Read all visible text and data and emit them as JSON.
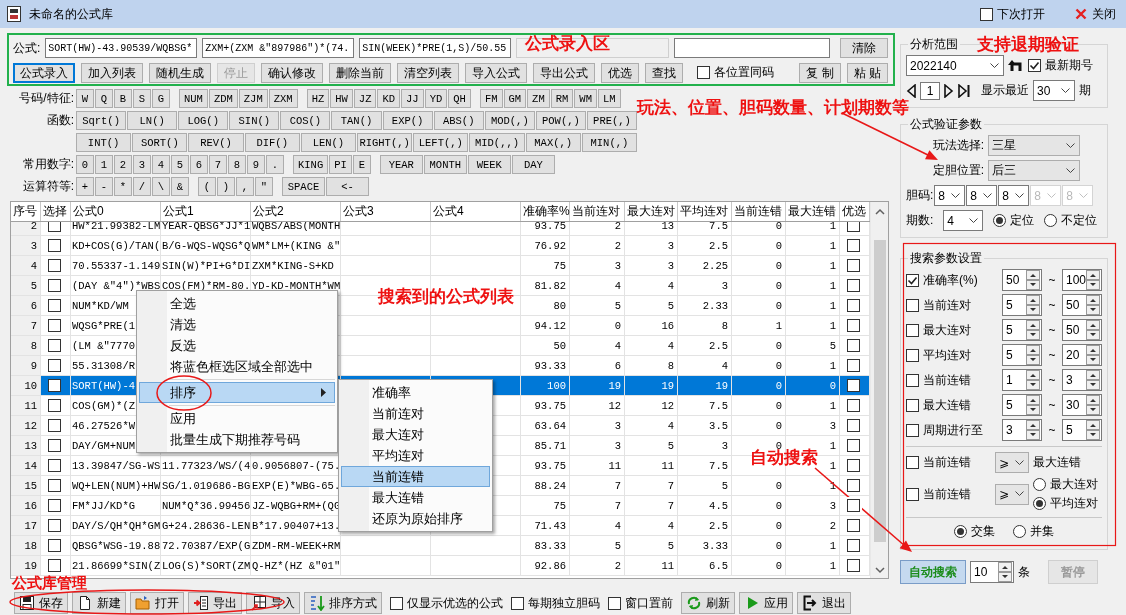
{
  "window": {
    "title": "未命名的公式库",
    "open_next_time": {
      "label": "下次打开",
      "checked": false
    },
    "close": "关闭"
  },
  "formula_area": {
    "label": "公式:",
    "inputs": [
      "SORT(HW)-43.90539/WQBSG*",
      "ZXM+(ZXM &\"897986\")*(74.",
      "SIN(WEEK)*PRE(1,S)/50.55"
    ],
    "clear": "清除",
    "buttons": [
      {
        "kind": "button",
        "label": "公式录入",
        "focused": true,
        "disabled": false
      },
      {
        "kind": "button",
        "label": "加入列表",
        "focused": false,
        "disabled": false
      },
      {
        "kind": "button",
        "label": "随机生成",
        "focused": false,
        "disabled": false
      },
      {
        "kind": "button",
        "label": "停止",
        "focused": false,
        "disabled": true
      },
      {
        "kind": "button",
        "label": "确认修改",
        "focused": false,
        "disabled": false
      },
      {
        "kind": "button",
        "label": "删除当前",
        "focused": false,
        "disabled": false
      },
      {
        "kind": "button",
        "label": "清空列表",
        "focused": false,
        "disabled": false
      },
      {
        "kind": "button",
        "label": "导入公式",
        "focused": false,
        "disabled": false
      },
      {
        "kind": "button",
        "label": "导出公式",
        "focused": false,
        "disabled": false
      },
      {
        "kind": "button",
        "label": "优选",
        "focused": false,
        "disabled": false
      },
      {
        "kind": "button",
        "label": "查找",
        "focused": false,
        "disabled": false
      },
      {
        "kind": "checkbox",
        "label": "各位置同码",
        "checked": false
      },
      {
        "kind": "button",
        "label": "复 制",
        "focused": false,
        "disabled": false
      },
      {
        "kind": "button",
        "label": "粘 贴",
        "focused": false,
        "disabled": false
      }
    ]
  },
  "keypad": {
    "rows": [
      {
        "label": "号码/特征:",
        "kind": "code",
        "groups": [
          {
            "kind": "code",
            "keys": [
              "W",
              "Q",
              "B",
              "S",
              "G"
            ]
          },
          {
            "kind": "code",
            "keys": [
              "NUM",
              "ZDM",
              "ZJM",
              "ZXM"
            ]
          },
          {
            "kind": "code",
            "keys": [
              "HZ",
              "HW",
              "JZ",
              "KD",
              "JJ",
              "YD",
              "QH"
            ]
          },
          {
            "kind": "code",
            "keys": [
              "FM",
              "GM",
              "ZM",
              "RM",
              "WM",
              "LM"
            ]
          }
        ]
      },
      {
        "label": "函数:",
        "kind": "function",
        "groups": [
          {
            "kind": "code",
            "keys": [
              "Sqrt()",
              "LN()",
              "LOG()",
              "SIN()",
              "COS()",
              "TAN()",
              "EXP()",
              "ABS()",
              "MOD(,)",
              "POW(,)",
              "PRE(,)"
            ]
          }
        ]
      },
      {
        "kind": "function",
        "groups": [
          {
            "kind": "code",
            "keys": [
              "INT()",
              "SORT()",
              "REV()",
              "DIF()",
              "LEN()",
              "RIGHT(,)",
              "LEFT(,)",
              "MID(,,)",
              "MAX(,)",
              "MIN(,)"
            ]
          }
        ]
      },
      {
        "label": "常用数字:",
        "kind": "code",
        "groups": [
          {
            "kind": "code",
            "keys": [
              "0",
              "1",
              "2",
              "3",
              "4",
              "5",
              "6",
              "7",
              "8",
              "9",
              "."
            ]
          },
          {
            "kind": "code",
            "keys": [
              "KING",
              "PI",
              "E"
            ]
          },
          {
            "kind": "word",
            "keys": [
              "YEAR",
              "MONTH",
              "WEEK",
              "DAY"
            ]
          }
        ]
      },
      {
        "label": "运算符等:",
        "kind": "code",
        "groups": [
          {
            "kind": "code",
            "keys": [
              "+",
              "-",
              "*",
              "/",
              "\\",
              "&"
            ]
          },
          {
            "kind": "code",
            "keys": [
              "(",
              ")",
              ",",
              "\""
            ]
          },
          {
            "kind": "word",
            "keys": [
              "SPACE",
              "<-"
            ]
          }
        ]
      }
    ]
  },
  "table": {
    "columns": [
      "序号",
      "选择",
      "公式0",
      "公式1",
      "公式2",
      "公式3",
      "公式4",
      "准确率%",
      "当前连对",
      "最大连对",
      "平均连对",
      "当前连错",
      "最大连错",
      "优选"
    ],
    "rows": [
      {
        "no": "2",
        "checked": false,
        "formulas": [
          "HW*21.99382-LM",
          "YEAR-QBSG*JJ*1",
          "WQBS/ABS(MONTH"
        ],
        "accuracy": "93.75",
        "current_wins": "2",
        "max_wins": "13",
        "average_wins": "7.5",
        "current_losses": "0",
        "max_losses": "1",
        "preferred": false,
        "selected": false
      },
      {
        "no": "3",
        "checked": false,
        "formulas": [
          "KD+COS(G)/TAN(",
          "B/G-WQS-WQSG*Q",
          "WM*LM+(KING &\""
        ],
        "accuracy": "76.92",
        "current_wins": "2",
        "max_wins": "3",
        "average_wins": "2.5",
        "current_losses": "0",
        "max_losses": "1",
        "preferred": false,
        "selected": false
      },
      {
        "no": "4",
        "checked": false,
        "formulas": [
          "70.55337-1.149",
          "SIN(W)*PI+G*DI",
          "ZXM*KING-S+KD"
        ],
        "accuracy": "75",
        "current_wins": "3",
        "max_wins": "3",
        "average_wins": "2.25",
        "current_losses": "0",
        "max_losses": "1",
        "preferred": false,
        "selected": false
      },
      {
        "no": "5",
        "checked": false,
        "formulas": [
          "(DAY &\"4\")*WBS",
          "COS(FM)*RM-80.",
          "YD-KD-MONTH*WM"
        ],
        "accuracy": "81.82",
        "current_wins": "4",
        "max_wins": "4",
        "average_wins": "3",
        "current_losses": "0",
        "max_losses": "1",
        "preferred": false,
        "selected": false
      },
      {
        "no": "6",
        "checked": false,
        "formulas": [
          "NUM*KD/WM"
        ],
        "accuracy": "80",
        "current_wins": "5",
        "max_wins": "5",
        "average_wins": "2.33",
        "current_losses": "0",
        "max_losses": "1",
        "preferred": false,
        "selected": false
      },
      {
        "no": "7",
        "checked": false,
        "formulas": [
          "WQSG*PRE(1"
        ],
        "accuracy": "94.12",
        "current_wins": "0",
        "max_wins": "16",
        "average_wins": "8",
        "current_losses": "1",
        "max_losses": "1",
        "preferred": false,
        "selected": false
      },
      {
        "no": "8",
        "checked": false,
        "formulas": [
          "(LM &\"7770"
        ],
        "accuracy": "50",
        "current_wins": "4",
        "max_wins": "4",
        "average_wins": "2.5",
        "current_losses": "0",
        "max_losses": "5",
        "preferred": false,
        "selected": false
      },
      {
        "no": "9",
        "checked": false,
        "formulas": [
          "55.31308/R"
        ],
        "accuracy": "93.33",
        "current_wins": "6",
        "max_wins": "8",
        "average_wins": "4",
        "current_losses": "0",
        "max_losses": "1",
        "preferred": false,
        "selected": false
      },
      {
        "no": "10",
        "checked": false,
        "formulas": [
          "SORT(HW)-4"
        ],
        "accuracy": "100",
        "current_wins": "19",
        "max_wins": "19",
        "average_wins": "19",
        "current_losses": "0",
        "max_losses": "0",
        "preferred": false,
        "selected": true
      },
      {
        "no": "11",
        "checked": false,
        "formulas": [
          "COS(GM)*(Z"
        ],
        "accuracy": "93.75",
        "current_wins": "12",
        "max_wins": "12",
        "average_wins": "7.5",
        "current_losses": "0",
        "max_losses": "1",
        "preferred": false,
        "selected": false
      },
      {
        "no": "12",
        "checked": false,
        "formulas": [
          "46.27526*W"
        ],
        "accuracy": "63.64",
        "current_wins": "3",
        "max_wins": "4",
        "average_wins": "3.5",
        "current_losses": "0",
        "max_losses": "3",
        "preferred": false,
        "selected": false
      },
      {
        "no": "13",
        "checked": false,
        "formulas": [
          "DAY/GM+NUM"
        ],
        "accuracy": "85.71",
        "current_wins": "3",
        "max_wins": "5",
        "average_wins": "3",
        "current_losses": "0",
        "max_losses": "1",
        "preferred": false,
        "selected": false
      },
      {
        "no": "14",
        "checked": false,
        "formulas": [
          "13.39847/SG-WS",
          "11.77323/WS/(4",
          "0.9056807-(75."
        ],
        "accuracy": "93.75",
        "current_wins": "11",
        "max_wins": "11",
        "average_wins": "7.5",
        "max_losses": "1",
        "preferred": false,
        "selected": false
      },
      {
        "no": "15",
        "checked": false,
        "formulas": [
          "WQ+LEN(NUM)+HW",
          "SG/1.019686-BG",
          "EXP(E)*WBG-65."
        ],
        "accuracy": "88.24",
        "current_wins": "7",
        "max_wins": "7",
        "average_wins": "5",
        "current_losses": "0",
        "max_losses": "1",
        "preferred": false,
        "selected": false
      },
      {
        "no": "16",
        "checked": false,
        "formulas": [
          "FM*JJ/KD*G",
          "NUM*Q*36.99456",
          "JZ-WQBG+RM+(QG"
        ],
        "accuracy": "75",
        "current_wins": "7",
        "max_wins": "7",
        "average_wins": "4.5",
        "current_losses": "0",
        "max_losses": "3",
        "preferred": false,
        "selected": false
      },
      {
        "no": "17",
        "checked": false,
        "formulas": [
          "DAY/S/QH*QH*GM",
          "G+24.28636-LEN",
          "B*17.90407+13."
        ],
        "accuracy": "71.43",
        "current_wins": "4",
        "max_wins": "4",
        "average_wins": "2.5",
        "current_losses": "0",
        "max_losses": "2",
        "preferred": false,
        "selected": false
      },
      {
        "no": "18",
        "checked": false,
        "formulas": [
          "QBSG*WSG-19.88",
          "72.70387/EXP(G",
          "ZDM-RM-WEEK+RM"
        ],
        "accuracy": "83.33",
        "current_wins": "5",
        "max_wins": "5",
        "average_wins": "3.33",
        "current_losses": "0",
        "max_losses": "1",
        "preferred": false,
        "selected": false
      },
      {
        "no": "19",
        "checked": false,
        "formulas": [
          "21.86699*SIN(Z",
          "LOG(S)*SORT(ZM",
          "Q-HZ*(HZ &\"01\""
        ],
        "accuracy": "92.86",
        "current_wins": "2",
        "max_wins": "11",
        "average_wins": "6.5",
        "current_losses": "0",
        "max_losses": "1",
        "preferred": false,
        "selected": false
      }
    ]
  },
  "context_menu": {
    "items": [
      {
        "label": "全选",
        "selected": false,
        "separator_before": false,
        "has_submenu": false
      },
      {
        "label": "清选",
        "selected": false,
        "separator_before": false,
        "has_submenu": false
      },
      {
        "label": "反选",
        "selected": false,
        "separator_before": false,
        "has_submenu": false
      },
      {
        "label": "将蓝色框选区域全部选中",
        "selected": false,
        "separator_before": false,
        "has_submenu": false
      },
      {
        "label": "排序",
        "selected": true,
        "separator_before": true,
        "has_submenu": true
      },
      {
        "label": "应用",
        "selected": false,
        "separator_before": true,
        "has_submenu": false
      },
      {
        "label": "批量生成下期推荐号码",
        "selected": false,
        "separator_before": false,
        "has_submenu": false
      }
    ],
    "submenu": [
      {
        "label": "准确率",
        "selected": false
      },
      {
        "label": "当前连对",
        "selected": false
      },
      {
        "label": "最大连对",
        "selected": false
      },
      {
        "label": "平均连对",
        "selected": false
      },
      {
        "label": "当前连错",
        "selected": true
      },
      {
        "label": "最大连错",
        "selected": false
      },
      {
        "label": "还原为原始排序",
        "selected": false
      }
    ]
  },
  "side_panel": {
    "analysis_range": {
      "title": "分析范围",
      "period": "2022140",
      "latest": {
        "label": "最新期号",
        "checked": true
      },
      "page": "1",
      "show_recent": "显示最近",
      "recent": "30",
      "unit": "期"
    },
    "verify": {
      "title": "公式验证参数",
      "play_label": "玩法选择:",
      "play": "三星",
      "position_label": "定胆位置:",
      "position": "后三",
      "dan_label": "胆码:",
      "dan": [
        {
          "value": "8",
          "disabled": false
        },
        {
          "value": "8",
          "disabled": false
        },
        {
          "value": "8",
          "disabled": false
        },
        {
          "value": "8",
          "disabled": true
        },
        {
          "value": "8",
          "disabled": true
        }
      ],
      "periods_label": "期数:",
      "periods": "4",
      "modes": [
        {
          "label": "定位",
          "selected": true
        },
        {
          "label": "不定位",
          "selected": false
        }
      ]
    },
    "search": {
      "title": "搜索参数设置",
      "ranges": [
        {
          "label": "准确率(%)",
          "checked": true,
          "min": "50",
          "sep": "~",
          "max": "100"
        },
        {
          "label": "当前连对",
          "checked": false,
          "min": "5",
          "sep": "~",
          "max": "50"
        },
        {
          "label": "最大连对",
          "checked": false,
          "min": "5",
          "sep": "~",
          "max": "50"
        },
        {
          "label": "平均连对",
          "checked": false,
          "min": "5",
          "sep": "~",
          "max": "20"
        },
        {
          "label": "当前连错",
          "checked": false,
          "min": "1",
          "sep": "~",
          "max": "3"
        },
        {
          "label": "最大连错",
          "checked": false,
          "min": "5",
          "sep": "~",
          "max": "30"
        },
        {
          "label": "周期进行至",
          "checked": false,
          "min": "3",
          "sep": "~",
          "max": "5"
        }
      ],
      "compare": [
        {
          "kind": "text",
          "label": "当前连错",
          "checked": false,
          "op": "⩾",
          "target": "最大连错"
        },
        {
          "kind": "radio",
          "label": "当前连错",
          "checked": false,
          "op": "⩾",
          "targets": [
            {
              "label": "最大连对",
              "selected": false
            },
            {
              "label": "平均连对",
              "selected": true
            }
          ]
        }
      ],
      "combine": [
        {
          "label": "交集",
          "selected": true
        },
        {
          "label": "并集",
          "selected": false
        }
      ]
    },
    "auto_search": {
      "button": "自动搜索",
      "count": "10",
      "unit": "条",
      "pause": {
        "label": "暂停",
        "disabled": true
      }
    }
  },
  "bottom_bar": {
    "buttons": [
      "保存",
      "新建",
      "打开",
      "导出",
      "导入",
      "排序方式"
    ],
    "options": [
      {
        "label": "仅显示优选的公式",
        "checked": false
      },
      {
        "label": "每期独立胆码",
        "checked": false
      },
      {
        "label": "窗口置前",
        "checked": false
      }
    ],
    "actions": [
      "刷新",
      "应用",
      "退出"
    ]
  },
  "annotations": [
    "公式录入区",
    "玩法、位置、胆码数量、计划期数等",
    "支持退期验证",
    "搜索到的公式列表",
    "自动搜索",
    "公式库管理"
  ]
}
